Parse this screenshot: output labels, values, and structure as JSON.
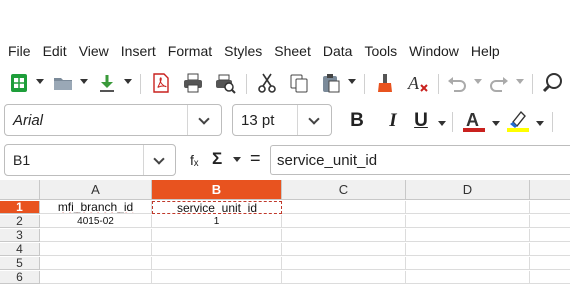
{
  "menubar": {
    "items": [
      "File",
      "Edit",
      "View",
      "Insert",
      "Format",
      "Styles",
      "Sheet",
      "Data",
      "Tools",
      "Window",
      "Help"
    ]
  },
  "toolbar": {
    "icons": [
      "new-spreadsheet-icon",
      "open-folder-icon",
      "save-icon",
      "export-pdf-icon",
      "print-icon",
      "print-preview-icon",
      "cut-icon",
      "copy-icon",
      "paste-icon",
      "clone-formatting-icon",
      "clear-formatting-icon",
      "undo-icon",
      "redo-icon",
      "find-replace-icon"
    ]
  },
  "format_bar": {
    "font_name": "Arial",
    "font_size": "13 pt",
    "bold_label": "B",
    "italic_label": "I",
    "underline_label": "U",
    "font_color": "#c9211e",
    "highlight_color": "#ffff00"
  },
  "formula_bar": {
    "name_box": "B1",
    "fx_label": "fₓ",
    "sum_label": "Σ",
    "equals_label": "=",
    "content": "service_unit_id"
  },
  "grid": {
    "columns": [
      "A",
      "B",
      "C",
      "D"
    ],
    "selected_column": "B",
    "rows": [
      "1",
      "2",
      "3",
      "4",
      "5",
      "6"
    ],
    "selected_row": "1",
    "cells": {
      "A1": "mfi_branch_id",
      "B1": "service_unit_id",
      "A2": "4015-02",
      "B2": "1"
    }
  },
  "colors": {
    "accent": "#e8531f",
    "selection_border": "#c0392b"
  }
}
